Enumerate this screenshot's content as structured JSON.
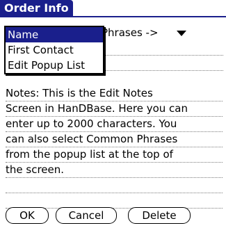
{
  "title": "Order Info",
  "popup": {
    "trigger_label": "Phrases ->",
    "items": [
      "Name",
      "First Contact",
      "Edit Popup List"
    ],
    "selected_index": 0
  },
  "notes": {
    "lines": [
      "Notes:  This is the Edit Notes",
      "Screen in HanDBase.  Here you can",
      "enter up to 2000 characters.  You",
      "can also select Common Phrases",
      "from the popup list at the top of",
      "the screen.",
      "",
      ""
    ]
  },
  "buttons": {
    "ok": "OK",
    "cancel": "Cancel",
    "delete": "Delete"
  },
  "colors": {
    "accent": "#1a1f8c"
  }
}
